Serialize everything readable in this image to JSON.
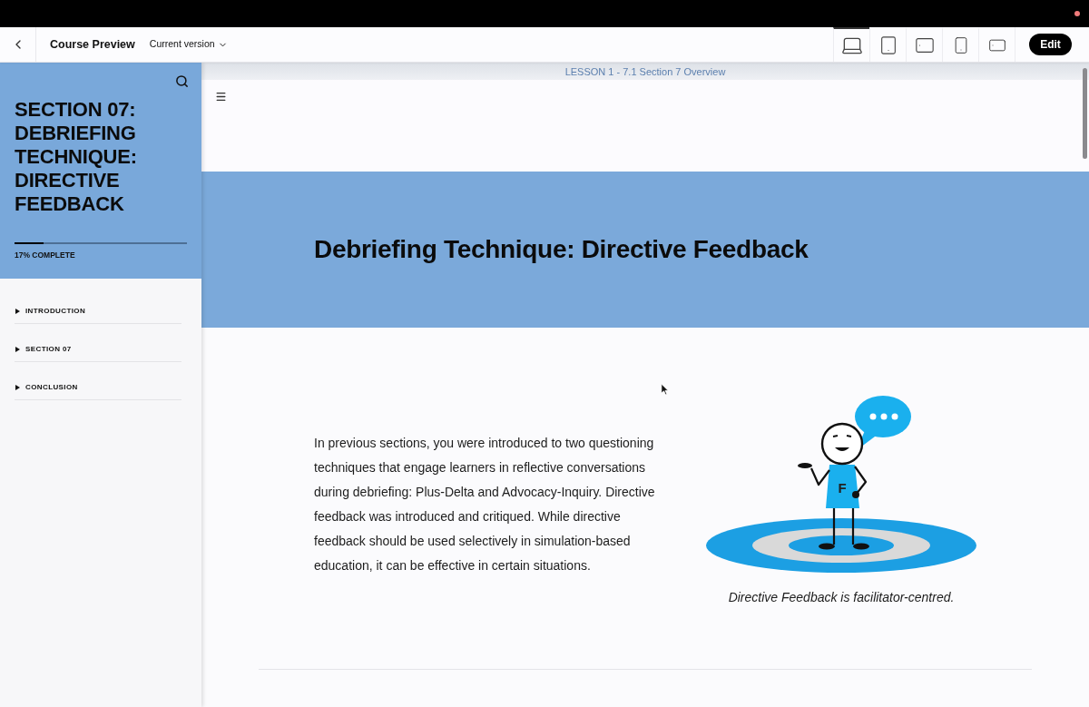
{
  "header": {
    "title": "Course Preview",
    "version_menu": "Current version",
    "devices": [
      {
        "kind": "laptop",
        "selected": true
      },
      {
        "kind": "tablet",
        "selected": false
      },
      {
        "kind": "tablet-landscape",
        "selected": false
      },
      {
        "kind": "phone",
        "selected": false
      },
      {
        "kind": "phone-landscape",
        "selected": false
      }
    ],
    "edit_button": "Edit"
  },
  "sidebar": {
    "title": "SECTION 07: DEBRIEFING TECHNIQUE: DIRECTIVE FEEDBACK",
    "progress": {
      "level": 0.17,
      "label": "17% COMPLETE"
    },
    "items": [
      {
        "label": "INTRODUCTION",
        "expanded": false
      },
      {
        "label": "SECTION 07",
        "expanded": false
      },
      {
        "label": "CONCLUSION",
        "expanded": false
      }
    ]
  },
  "lesson": {
    "breadcrumb": "LESSON 1 - 7.1 Section 7 Overview",
    "banner_title": "Debriefing Technique: Directive Feedback",
    "paragraph": "In previous sections, you were introduced to two questioning techniques that engage learners in reflective conversations during debriefing: Plus-Delta and Advocacy-Inquiry. Directive feedback was introduced and critiqued. While directive feedback should be used selectively in simulation-based education, it can be effective in certain situations.",
    "figure": {
      "shirt_letter": "F",
      "caption": "Directive Feedback is facilitator-centred."
    }
  }
}
